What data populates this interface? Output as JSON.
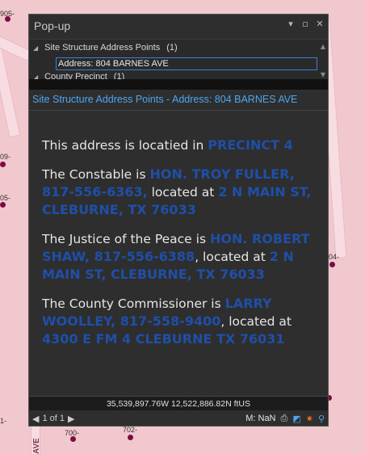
{
  "map": {
    "labels": {
      "l905": "905-",
      "l09": "09-",
      "l05": "05-",
      "l04": "04-",
      "l1": "1-",
      "l700": "700-",
      "l702": "702-"
    },
    "street": "AVE"
  },
  "popup": {
    "title": "Pop-up",
    "tree": {
      "layer_name": "Site Structure Address Points",
      "layer_count": "(1)",
      "selected_feature": "Address: 804 BARNES AVE",
      "next_layer_name": "County Precinct",
      "next_layer_count": "(1)"
    },
    "feature_header": "Site Structure Address Points - Address: 804 BARNES AVE",
    "content": {
      "p1_text": "This address is locatied in ",
      "p1_precinct": "PRECINCT 4",
      "p2_text": "The Constable is ",
      "p2_name": "HON. TROY FULLER, 817-556-6363,",
      "p2_mid": " located at ",
      "p2_addr": "2 N MAIN ST, CLEBURNE, TX 76033",
      "p3_text": "The Justice of the Peace is ",
      "p3_name": "HON. ROBERT SHAW, 817-556-6388",
      "p3_mid": ", located at ",
      "p3_addr": "2 N MAIN ST, CLEBURNE, TX 76033",
      "p4_text": "The County Commissioner is ",
      "p4_name": "LARRY WOOLLEY, 817-558-9400",
      "p4_mid": ", located at ",
      "p4_addr": "4300 E FM 4 CLEBURNE TX 76031"
    },
    "coordinates": "35,539,897.76W 12,522,886.82N ftUS",
    "footer": {
      "page": "1 of 1",
      "measure": "M: NaN"
    }
  },
  "colors": {
    "accent_blue": "#1f4fa8",
    "header_blue": "#4da6f0",
    "panel_bg": "#2e2e2e",
    "map_bg": "#f2c8cf"
  }
}
